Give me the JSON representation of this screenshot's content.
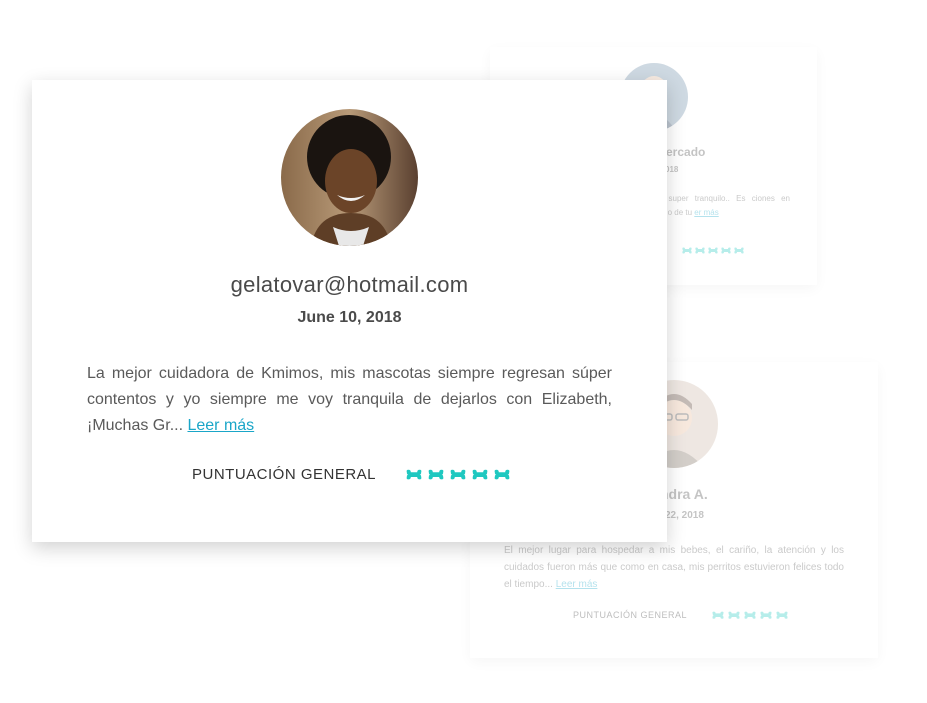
{
  "cards": [
    {
      "name": "gelatovar@hotmail.com",
      "date": "June 10, 2018",
      "review": "La mejor cuidadora de Kmimos, mis mascotas siempre regresan súper contentos y yo siempre me voy tranquila de dejarlos con Elizabeth, ¡Muchas Gr...",
      "read_more": "Leer más",
      "rating_label": "PUNTUACIÓN GENERAL",
      "rating": 5
    },
    {
      "name": "Mercado",
      "date": "018",
      "review": "quedo super tranquilo.. Es ciones en beneficio de tu",
      "read_more": "er más",
      "rating_label": "L",
      "rating": 5
    },
    {
      "name": "ndra A.",
      "date": "22, 2018",
      "review": "El mejor lugar para hospedar a mis bebes, el cariño, la atención y los cuidados fueron más que como en casa, mis perritos estuvieron felices todo el tiempo...",
      "read_more": "Leer más",
      "rating_label": "PUNTUACIÓN GENERAL",
      "rating": 5
    }
  ],
  "colors": {
    "bone": "#1fc8c0",
    "link": "#1aa6c8"
  },
  "icons": {
    "rating_icon": "bone-icon",
    "avatar": "avatar-photo"
  }
}
